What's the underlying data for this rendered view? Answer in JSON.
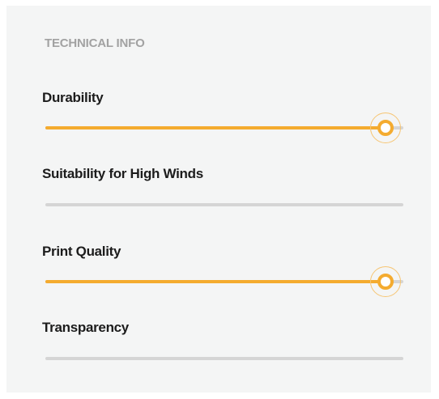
{
  "section": {
    "title": "TECHNICAL INFO"
  },
  "ratings": [
    {
      "label": "Durability",
      "value": 0.95
    },
    {
      "label": "Suitability for High Winds",
      "value": 0.0
    },
    {
      "label": "Print Quality",
      "value": 0.95
    },
    {
      "label": "Transparency",
      "value": 0.0
    }
  ],
  "colors": {
    "accent": "#f4ab2f",
    "track": "#d5d5d5",
    "panel_background": "#f4f5f5",
    "heading": "#a2a2a2",
    "label": "#1c1c1c"
  }
}
